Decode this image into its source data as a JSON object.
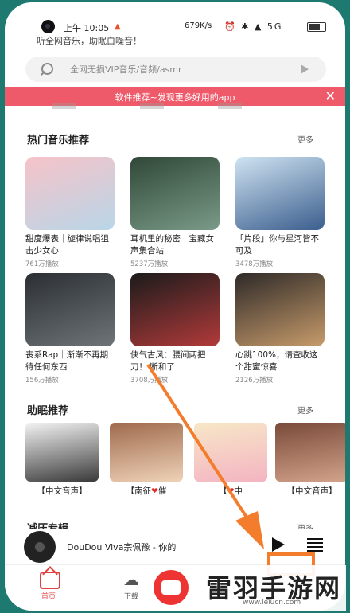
{
  "status": {
    "time": "上午 10:05",
    "speed": "679K/s",
    "icons": "⏰ ✱ ▲ 5G"
  },
  "tagline": "听全网音乐，助眠白噪音！",
  "search": {
    "placeholder": "全网无损VIP音乐/音频/asmr"
  },
  "banner": {
    "text": "软件推荐~发现更多好用的app",
    "close": "✕"
  },
  "hot": {
    "title": "热门音乐推荐",
    "more": "更多",
    "cards": [
      {
        "title": "甜度爆表｜旋律说唱狙击少女心",
        "plays": "761万播放",
        "c1": "#f6c3c8",
        "c2": "#b9d6e8"
      },
      {
        "title": "耳机里的秘密｜宝藏女声集合站",
        "plays": "5237万播放",
        "c1": "#304838",
        "c2": "#7a9a88"
      },
      {
        "title": "「片段」你与星河皆不可及",
        "plays": "3478万播放",
        "c1": "#cfe3f1",
        "c2": "#3b5e8e"
      },
      {
        "title": "丧系Rap｜渐渐不再期待任何东西",
        "plays": "156万播放",
        "c1": "#2b2f34",
        "c2": "#6e7478"
      },
      {
        "title": "侠气古风：腰间两把刀！ 断和了",
        "plays": "3708万播放",
        "c1": "#1b1b1b",
        "c2": "#b23a3a"
      },
      {
        "title": "心跳100%，请查收这个甜蜜惊喜",
        "plays": "2126万播放",
        "c1": "#2e2a28",
        "c2": "#c79b6b"
      }
    ]
  },
  "sleep": {
    "title": "助眠推荐",
    "more": "更多",
    "items": [
      {
        "pre": "【中文音声】",
        "post": "",
        "c1": "#f3f3f3",
        "c2": "#3a3a3a"
      },
      {
        "pre": "【南征",
        "post": "催",
        "c1": "#a06a4c",
        "c2": "#eed2b8"
      },
      {
        "pre": "【",
        "post": "中",
        "c1": "#f7e7c7",
        "c2": "#f4b4c2"
      },
      {
        "pre": "【中文音声】",
        "post": "",
        "c1": "#7a4a3a",
        "c2": "#d2a28a"
      }
    ]
  },
  "decompress": {
    "title": "减压专辑",
    "more": "更多"
  },
  "player": {
    "song": "DouDou Viva宗佩豫 - 你的"
  },
  "tabs": {
    "home": "首页",
    "download": "下载"
  },
  "watermark": {
    "title": "雷羽手游网",
    "url": "www.leiucn.com"
  },
  "colors": {
    "accent": "#e04040",
    "banner": "#ef5a6a",
    "annotation": "#f37d2c"
  }
}
